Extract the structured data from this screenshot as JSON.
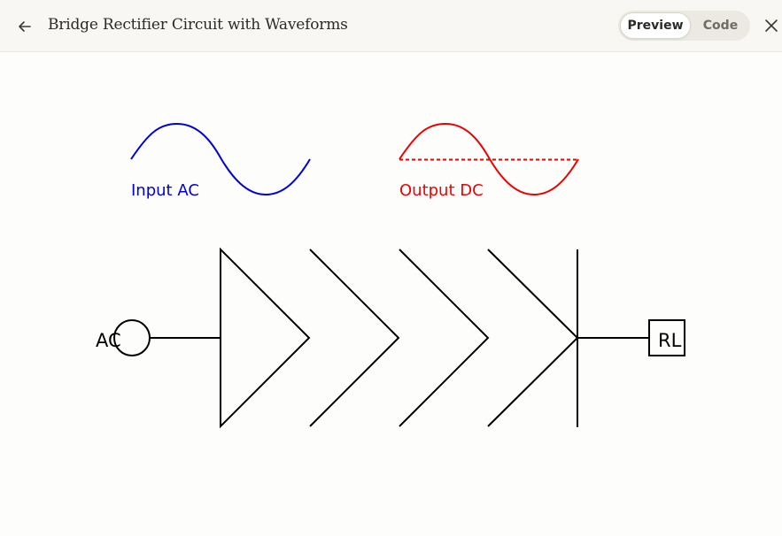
{
  "header": {
    "title": "Bridge Rectifier Circuit with Waveforms",
    "back_icon": "arrow-left-icon",
    "close_icon": "close-icon",
    "tabs": {
      "preview": "Preview",
      "code": "Code"
    },
    "active_tab": "Preview"
  },
  "diagram": {
    "input_label": "Input AC",
    "output_label": "Output DC",
    "source_label": "AC",
    "load_label": "RL",
    "colors": {
      "input_wave": "#0000dd",
      "output_wave": "#ee0000",
      "circuit": "#000000"
    }
  }
}
